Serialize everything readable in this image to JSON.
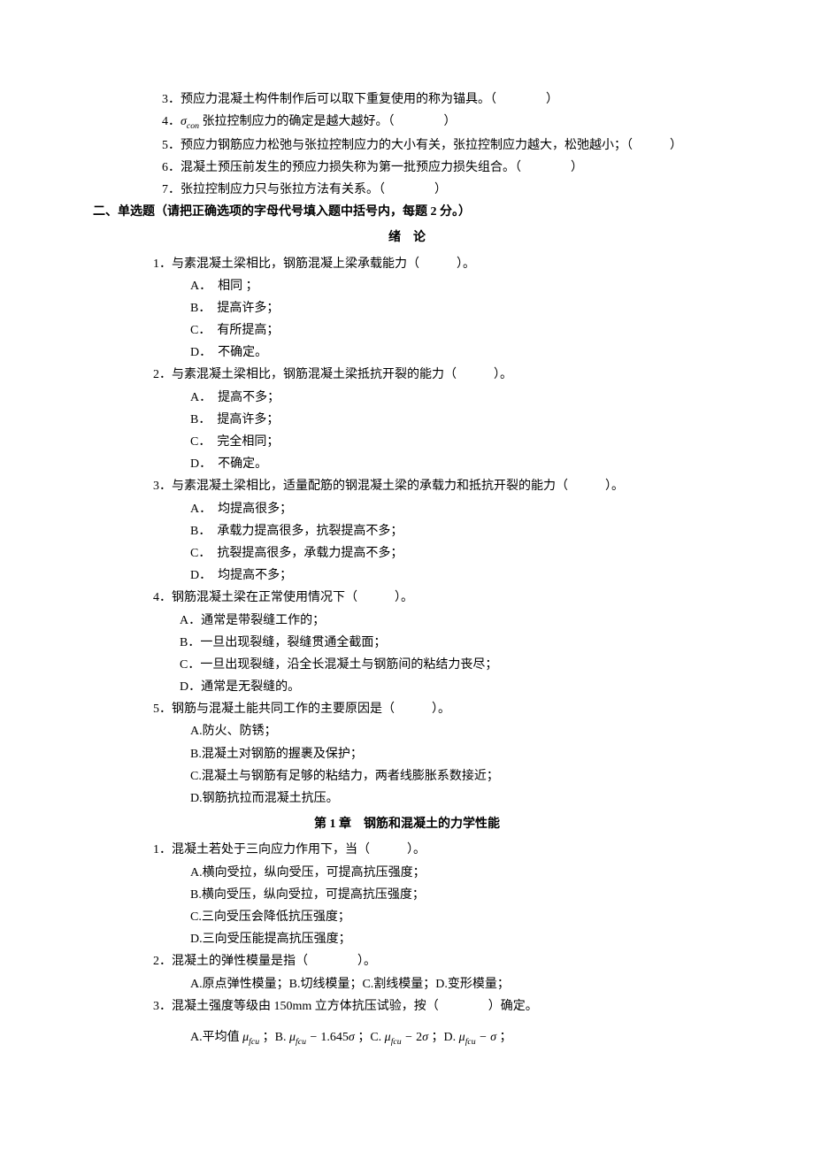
{
  "tf": {
    "q3": "3．预应力混凝土构件制作后可以取下重复使用的称为锚具。（　　　　）",
    "q4": "4．σcon 张拉控制应力的确定是越大越好。（　　　　）",
    "q5": "5．预应力钢筋应力松弛与张拉控制应力的大小有关，张拉控制应力越大，松弛越小；（　　　）",
    "q6": "6．混凝土预压前发生的预应力损失称为第一批预应力损失组合。（　　　　）",
    "q7": "7．张拉控制应力只与张拉方法有关系。（　　　　）"
  },
  "section2": "二、单选题（请把正确选项的字母代号填入题中括号内，每题 2 分。）",
  "title_intro": "绪　论",
  "intro": {
    "q1": {
      "stem": "1．与素混凝土梁相比，钢筋混凝上梁承载能力（　　　）。",
      "a": "A．　相同 ；",
      "b": "B．　提高许多；",
      "c": "C．　有所提高；",
      "d": "D．　不确定。"
    },
    "q2": {
      "stem": "2．与素混凝土梁相比，钢筋混凝土梁抵抗开裂的能力（　　　）。",
      "a": "A．　提高不多；",
      "b": "B．　提高许多；",
      "c": "C．　完全相同；",
      "d": "D．　不确定。"
    },
    "q3": {
      "stem": "3．与素混凝土梁相比，适量配筋的钢混凝土梁的承载力和抵抗开裂的能力（　　　）。",
      "a": "A．　均提高很多；",
      "b": "B．　承载力提高很多，抗裂提高不多；",
      "c": "C．　抗裂提高很多，承载力提高不多；",
      "d": "D．　均提高不多；"
    },
    "q4": {
      "stem": "4．钢筋混凝土梁在正常使用情况下（　　　）。",
      "a": "A．通常是带裂缝工作的；",
      "b": "B．一旦出现裂缝，裂缝贯通全截面；",
      "c": "C．一旦出现裂缝，沿全长混凝土与钢筋间的粘结力丧尽；",
      "d": "D．通常是无裂缝的。"
    },
    "q5": {
      "stem": "5．钢筋与混凝土能共同工作的主要原因是（　　　）。",
      "a": "A.防火、防锈；",
      "b": "B.混凝土对钢筋的握裹及保护；",
      "c": "C.混凝土与钢筋有足够的粘结力，两者线膨胀系数接近；",
      "d": "D.钢筋抗拉而混凝土抗压。"
    }
  },
  "title_ch1": "第 1 章 钢筋和混凝土的力学性能",
  "ch1": {
    "q1": {
      "stem": "1．混凝土若处于三向应力作用下，当（　　　）。",
      "a": "A.横向受拉，纵向受压，可提高抗压强度；",
      "b": "B.横向受压，纵向受拉，可提高抗压强度；",
      "c": "C.三向受压会降低抗压强度；",
      "d": "D.三向受压能提高抗压强度；"
    },
    "q2": {
      "stem": "2．混凝土的弹性模量是指（　　　　）。",
      "opts": "A.原点弹性模量；B.切线模量；C.割线模量；D.变形模量；"
    },
    "q3": {
      "stem": "3．混凝土强度等级由 150mm 立方体抗压试验，按（　　　　）确定。",
      "a_pre": "A.平均值 ",
      "a_post": " ；B. ",
      "b_post": " ；C. ",
      "c_post": " ；D. ",
      "d_post": " ；",
      "mu": "μ",
      "sub": "fcu",
      "minus": " − ",
      "v1": "1.645",
      "v2": "2",
      "sigma": "σ"
    }
  }
}
